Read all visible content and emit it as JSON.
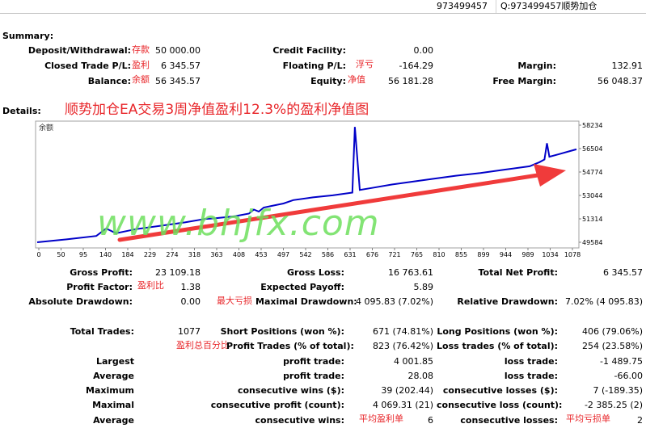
{
  "header": {
    "account": "973499457",
    "title": "Q:973499457顺势加仓"
  },
  "summary": {
    "label": "Summary:",
    "deposit_label": "Deposit/Withdrawal:",
    "deposit_note": "存款",
    "deposit_value": "50 000.00",
    "credit_label": "Credit Facility:",
    "credit_value": "0.00",
    "closed_label": "Closed Trade P/L:",
    "closed_note": "盈利",
    "closed_value": "6 345.57",
    "floating_label": "Floating P/L:",
    "floating_note": "浮亏",
    "floating_value": "-164.29",
    "margin_label": "Margin:",
    "margin_value": "132.91",
    "balance_label": "Balance:",
    "balance_note": "余额",
    "balance_value": "56 345.57",
    "equity_label": "Equity:",
    "equity_note": "净值",
    "equity_value": "56 181.28",
    "free_margin_label": "Free Margin:",
    "free_margin_value": "56 048.37"
  },
  "details": {
    "label": "Details:",
    "chart_caption": "顺势加仓EA交易3周净值盈利12.3%的盈利净值图",
    "chart_inner_label": "余额",
    "watermark": "www.bhjfx.com"
  },
  "chart_data": {
    "type": "line",
    "x": [
      0,
      60,
      120,
      140,
      160,
      200,
      250,
      300,
      340,
      360,
      400,
      430,
      440,
      450,
      460,
      480,
      500,
      520,
      560,
      600,
      640,
      645,
      655,
      680,
      720,
      760,
      800,
      850,
      900,
      950,
      1000,
      1020,
      1030,
      1035,
      1040,
      1060,
      1080,
      1095
    ],
    "y": [
      49584,
      49800,
      50050,
      50600,
      50250,
      50550,
      50800,
      51050,
      51300,
      51350,
      51500,
      51700,
      52000,
      51850,
      52150,
      52300,
      52450,
      52700,
      52900,
      53050,
      53250,
      58100,
      53450,
      53600,
      53850,
      54050,
      54250,
      54500,
      54700,
      54950,
      55200,
      55500,
      55700,
      56900,
      55900,
      56100,
      56300,
      56450
    ],
    "xlim": [
      0,
      1095
    ],
    "ylim": [
      49584,
      58234
    ],
    "x_ticks": [
      "0",
      "50",
      "95",
      "140",
      "184",
      "229",
      "274",
      "318",
      "363",
      "408",
      "453",
      "497",
      "542",
      "586",
      "631",
      "676",
      "721",
      "765",
      "810",
      "855",
      "899",
      "944",
      "989",
      "1034",
      "1078"
    ],
    "y_ticks": [
      "58234",
      "56504",
      "54774",
      "53044",
      "51314",
      "49584"
    ],
    "series_color": "#0000c8",
    "arrow_color": "#f03b3b",
    "grid": false
  },
  "stats": {
    "gross_profit_label": "Gross Profit:",
    "gross_profit_value": "23 109.18",
    "gross_loss_label": "Gross Loss:",
    "gross_loss_value": "16 763.61",
    "total_net_label": "Total Net Profit:",
    "total_net_value": "6 345.57",
    "profit_factor_label": "Profit Factor:",
    "profit_factor_note": "盈利比",
    "profit_factor_value": "1.38",
    "expected_payoff_label": "Expected Payoff:",
    "expected_payoff_value": "5.89",
    "abs_dd_label": "Absolute Drawdown:",
    "abs_dd_value": "0.00",
    "max_dd_note": "最大亏损",
    "max_dd_label": "Maximal Drawdown:",
    "max_dd_value": "4 095.83 (7.02%)",
    "rel_dd_label": "Relative Drawdown:",
    "rel_dd_value": "7.02% (4 095.83)",
    "total_trades_label": "Total Trades:",
    "total_trades_value": "1077",
    "short_label": "Short Positions (won %):",
    "short_value": "671 (74.81%)",
    "long_label": "Long Positions (won %):",
    "long_value": "406 (79.06%)",
    "profit_trades_note": "盈利总百分比",
    "profit_trades_label": "Profit Trades (% of total):",
    "profit_trades_value": "823 (76.42%)",
    "loss_trades_label": "Loss trades (% of total):",
    "loss_trades_value": "254 (23.58%)",
    "largest_label": "Largest",
    "largest_profit_label": "profit trade:",
    "largest_profit_value": "4 001.85",
    "largest_loss_label": "loss trade:",
    "largest_loss_value": "-1 489.75",
    "average_label": "Average",
    "average_profit_label": "profit trade:",
    "average_profit_value": "28.08",
    "average_loss_label": "loss trade:",
    "average_loss_value": "-66.00",
    "maximum_label": "Maximum",
    "max_cons_wins_label": "consecutive wins ($):",
    "max_cons_wins_value": "39 (202.44)",
    "max_cons_losses_label": "consecutive losses ($):",
    "max_cons_losses_value": "7 (-189.35)",
    "maximal_label": "Maximal",
    "maximal_profit_label": "consecutive profit (count):",
    "maximal_profit_value": "4 069.31 (21)",
    "maximal_loss_label": "consecutive loss (count):",
    "maximal_loss_value": "-2 385.25 (2)",
    "avg_cons_label": "Average",
    "avg_cons_wins_label": "consecutive wins:",
    "avg_cons_wins_note": "平均盈利单",
    "avg_cons_wins_value": "6",
    "avg_cons_losses_label": "consecutive losses:",
    "avg_cons_losses_note": "平均亏损单",
    "avg_cons_losses_value": "2"
  }
}
